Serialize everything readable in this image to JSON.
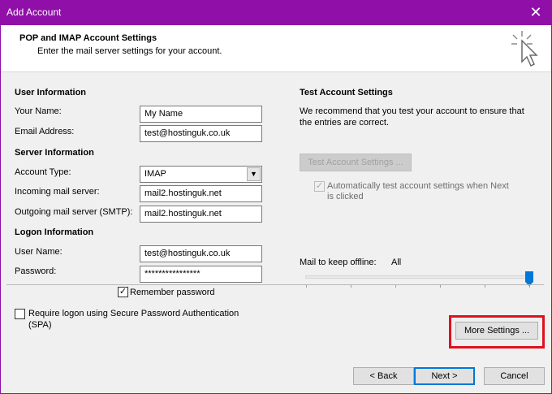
{
  "window": {
    "title": "Add Account",
    "close_glyph": "✕"
  },
  "header": {
    "title": "POP and IMAP Account Settings",
    "subtitle": "Enter the mail server settings for your account.",
    "icon": "click-cursor-icon"
  },
  "user_information": {
    "heading": "User Information",
    "your_name_label": "Your Name:",
    "your_name_value": "My Name",
    "email_label": "Email Address:",
    "email_value": "test@hostinguk.co.uk"
  },
  "server_information": {
    "heading": "Server Information",
    "account_type_label": "Account Type:",
    "account_type_value": "IMAP",
    "incoming_label": "Incoming mail server:",
    "incoming_value": "mail2.hostinguk.net",
    "outgoing_label": "Outgoing mail server (SMTP):",
    "outgoing_value": "mail2.hostinguk.net"
  },
  "logon_information": {
    "heading": "Logon Information",
    "username_label": "User Name:",
    "username_value": "test@hostinguk.co.uk",
    "password_label": "Password:",
    "password_value": "****************",
    "remember_label": "Remember password",
    "remember_checked": true,
    "spa_label_line1": "Require logon using Secure Password Authentication",
    "spa_label_line2": "(SPA)",
    "spa_checked": false
  },
  "test_settings": {
    "heading": "Test Account Settings",
    "description_line1": "We recommend that you test your account to ensure that",
    "description_line2": "the entries are correct.",
    "test_button": "Test Account Settings ...",
    "auto_test_line1": "Automatically test account settings when Next",
    "auto_test_line2": "is clicked",
    "auto_test_checked": true
  },
  "offline": {
    "label": "Mail to keep offline:",
    "value": "All",
    "level_fraction": 1.0
  },
  "buttons": {
    "more_settings": "More Settings ...",
    "back": "< Back",
    "next": "Next >",
    "cancel": "Cancel"
  },
  "colors": {
    "titlebar": "#8f0fa8",
    "highlight": "#e0101f",
    "accent": "#0078d7"
  }
}
